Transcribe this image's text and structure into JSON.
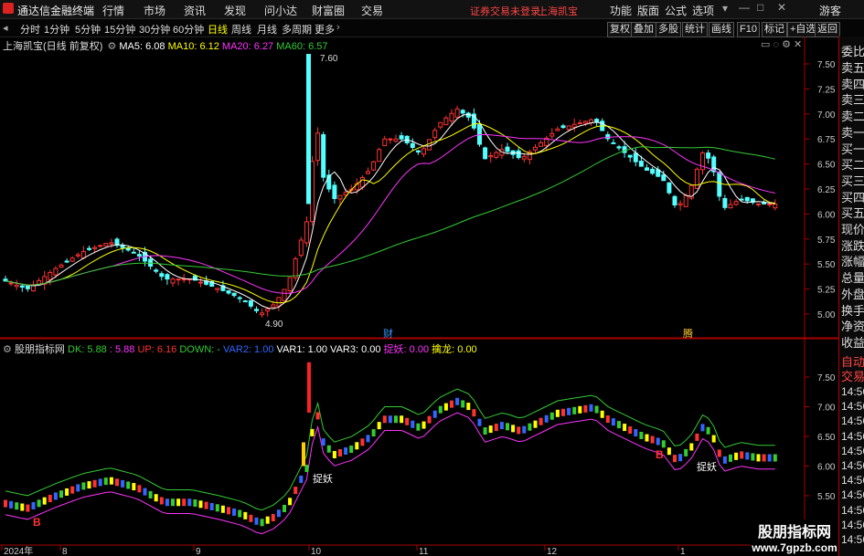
{
  "menubar": {
    "app_title": "通达信金融终端",
    "items": [
      "行情",
      "市场",
      "资讯",
      "发现",
      "问小达",
      "财富圈",
      "交易"
    ],
    "login_notice": "证券交易未登录",
    "stock_name": "上海凯宝",
    "right_items": [
      "功能",
      "版面",
      "公式",
      "选项"
    ],
    "user": "游客"
  },
  "toolbar": {
    "periods": [
      "分时",
      "1分钟",
      "5分钟",
      "15分钟",
      "30分钟",
      "60分钟",
      "日线",
      "周线",
      "月线",
      "多周期",
      "更多"
    ],
    "active_period": "日线",
    "right_buttons": [
      "复权",
      "叠加",
      "多股",
      "统计",
      "画线",
      "F10",
      "标记",
      "+自选",
      "返回"
    ]
  },
  "main_chart": {
    "title": "上海凯宝(日线 前复权)",
    "indicators": [
      {
        "label": "MA5: 6.08",
        "color": "#ffffff"
      },
      {
        "label": "MA10: 6.12",
        "color": "#ffff00"
      },
      {
        "label": "MA20: 6.27",
        "color": "#ff33ff"
      },
      {
        "label": "MA60: 6.57",
        "color": "#33cc33"
      }
    ],
    "y_ticks": [
      "7.50",
      "7.25",
      "7.00",
      "6.75",
      "6.50",
      "6.25",
      "6.00",
      "5.75",
      "5.50",
      "5.25",
      "5.00"
    ],
    "high_label": "7.60",
    "low_label": "4.90",
    "markers": [
      "财",
      "腾"
    ]
  },
  "sub_chart": {
    "title": "股朋指标网",
    "indicators": [
      {
        "label": "DK: 5.88",
        "color": "#33cc33"
      },
      {
        "label": ": 5.88",
        "color": "#ff33ff"
      },
      {
        "label": "UP: 6.16",
        "color": "#ff3333"
      },
      {
        "label": "DOWN: -",
        "color": "#33cc33"
      },
      {
        "label": "VAR2: 1.00",
        "color": "#3366ff"
      },
      {
        "label": "VAR1: 1.00",
        "color": "#ffffff"
      },
      {
        "label": "VAR3: 0.00",
        "color": "#ffffff"
      },
      {
        "label": "捉妖: 0.00",
        "color": "#ff33ff"
      },
      {
        "label": "擒龙: 0.00",
        "color": "#ffff00"
      }
    ],
    "y_ticks": [
      "7.50",
      "7.00",
      "6.50",
      "6.00",
      "5.50"
    ],
    "annotations": [
      "捉妖",
      "捉妖"
    ],
    "b_label": "B"
  },
  "x_axis": {
    "labels": [
      "2024年",
      "8",
      "9",
      "10",
      "11",
      "12",
      "1"
    ]
  },
  "side_panel": {
    "top_label": "委比",
    "items": [
      "卖五",
      "卖四",
      "卖三",
      "卖二",
      "卖一",
      "买一",
      "买二",
      "买三",
      "买四",
      "买五",
      "现价",
      "涨跌",
      "涨幅",
      "总量",
      "外盘",
      "换手",
      "净资",
      "收益"
    ],
    "bottom": [
      "自动",
      "交易"
    ],
    "times": [
      "14:56",
      "14:56",
      "14:56",
      "14:56",
      "14:56",
      "14:56",
      "14:56",
      "14:56",
      "14:56",
      "14:56",
      "14:56"
    ]
  },
  "watermark": {
    "line1": "股朋指标网",
    "line2": "www.7gpzb.com"
  }
}
